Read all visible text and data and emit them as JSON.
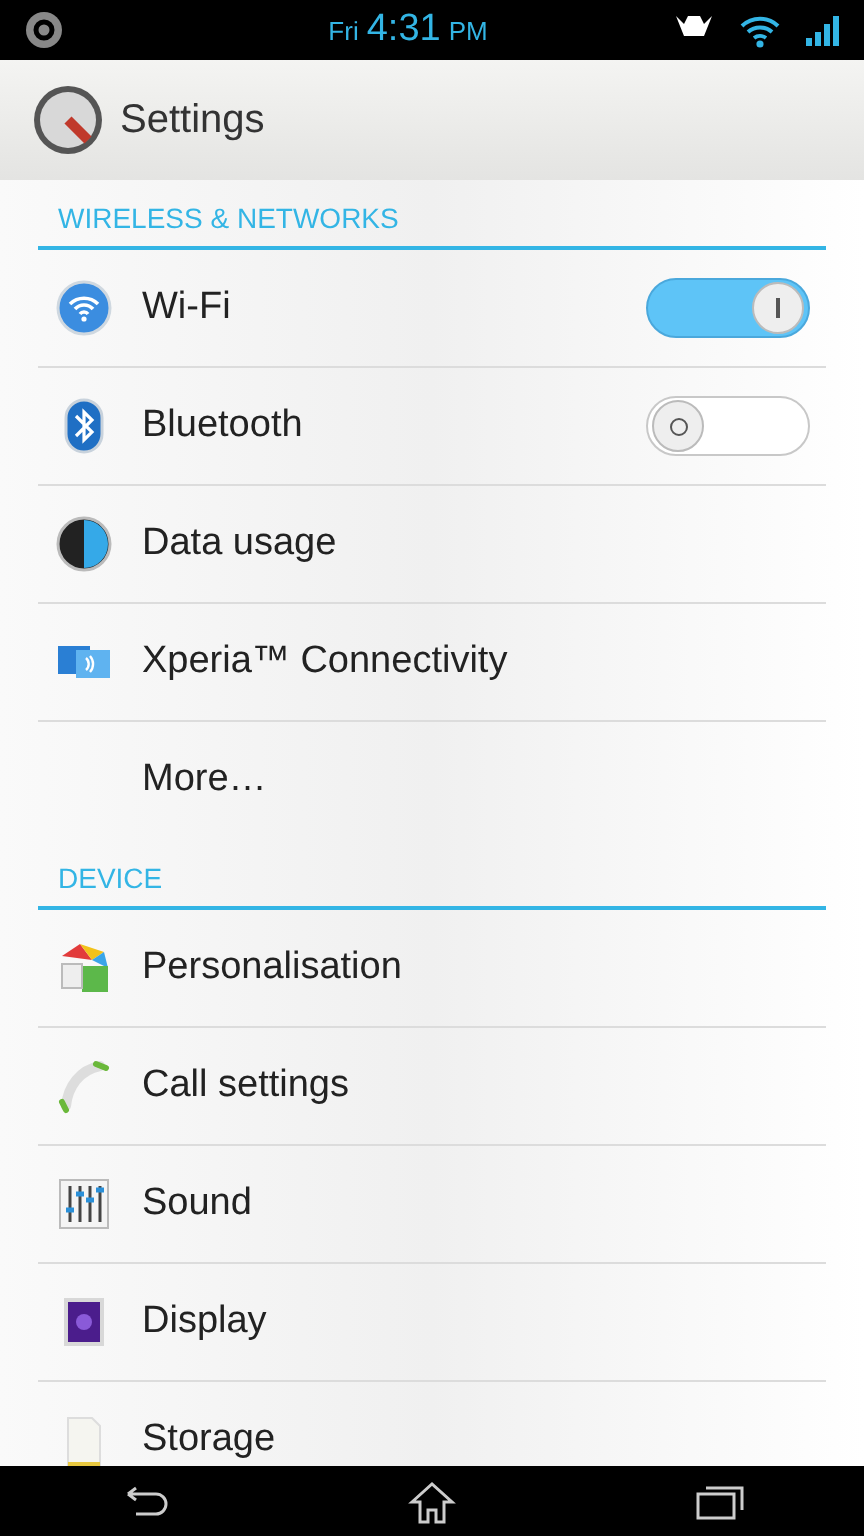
{
  "status_bar": {
    "day": "Fri",
    "time": "4:31",
    "ampm": "PM"
  },
  "header": {
    "title": "Settings"
  },
  "sections": [
    {
      "title": "WIRELESS & NETWORKS",
      "items": [
        {
          "label": "Wi-Fi",
          "kind": "toggle",
          "on": true
        },
        {
          "label": "Bluetooth",
          "kind": "toggle",
          "on": false
        },
        {
          "label": "Data usage",
          "kind": "plain"
        },
        {
          "label": "Xperia™ Connectivity",
          "kind": "plain"
        },
        {
          "label": "More…",
          "kind": "plain"
        }
      ]
    },
    {
      "title": "DEVICE",
      "items": [
        {
          "label": "Personalisation",
          "kind": "plain"
        },
        {
          "label": "Call settings",
          "kind": "plain"
        },
        {
          "label": "Sound",
          "kind": "plain"
        },
        {
          "label": "Display",
          "kind": "plain"
        },
        {
          "label": "Storage",
          "kind": "plain"
        }
      ]
    }
  ]
}
